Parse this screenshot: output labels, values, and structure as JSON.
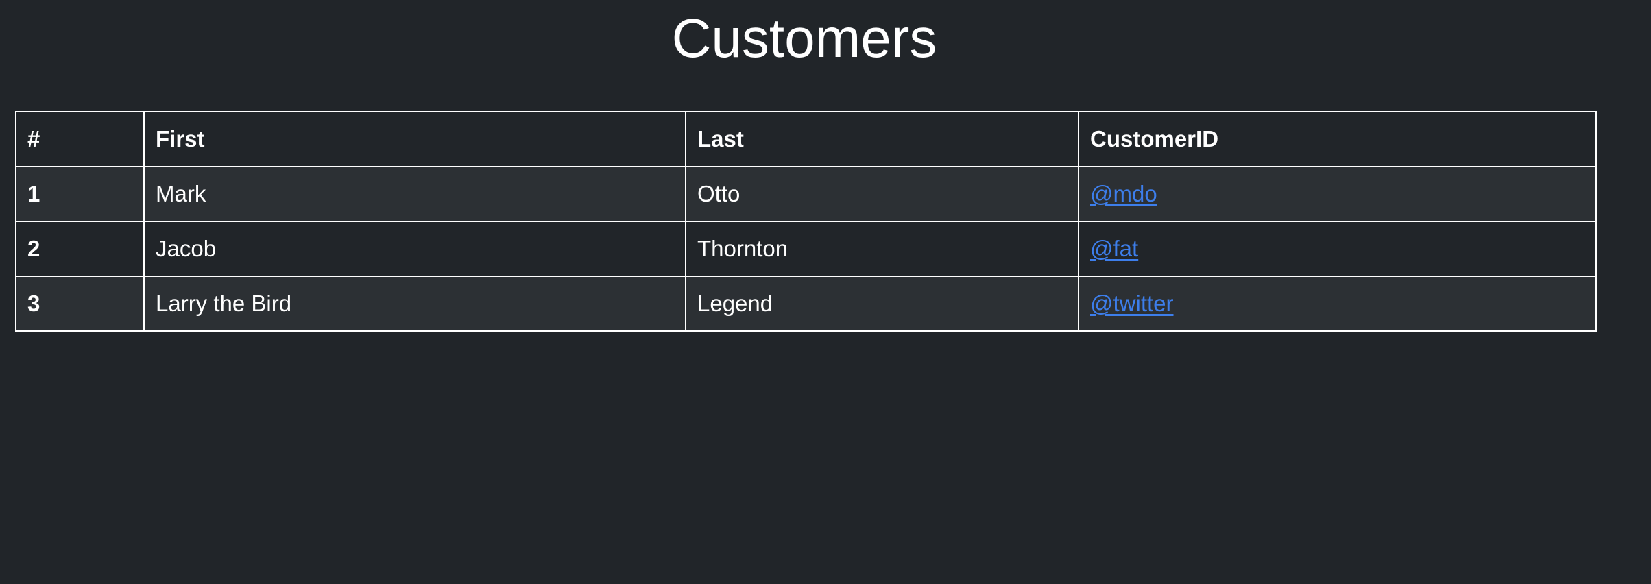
{
  "page": {
    "title": "Customers"
  },
  "theme": {
    "background": "#212529",
    "stripe": "#2c3034",
    "text": "#ffffff",
    "link": "#3d7eeb",
    "border": "#ffffff"
  },
  "table": {
    "headers": [
      "#",
      "First",
      "Last",
      "CustomerID"
    ],
    "rows": [
      {
        "num": "1",
        "first": "Mark",
        "last": "Otto",
        "customer_id": "@mdo"
      },
      {
        "num": "2",
        "first": "Jacob",
        "last": "Thornton",
        "customer_id": "@fat"
      },
      {
        "num": "3",
        "first": "Larry the Bird",
        "last": "Legend",
        "customer_id": "@twitter"
      }
    ]
  }
}
